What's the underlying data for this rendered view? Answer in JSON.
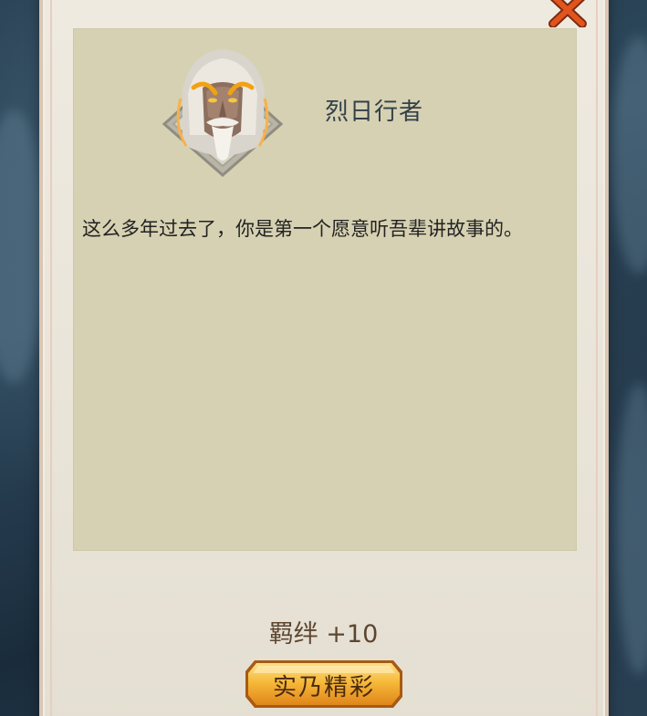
{
  "dialog": {
    "speaker_name": "烈日行者",
    "text": "这么多年过去了，你是第一个愿意听吾辈讲故事的。",
    "portrait_icon": "elder-portrait-icon"
  },
  "reward": {
    "label": "羁绊 +10"
  },
  "actions": {
    "confirm_label": "实乃精彩",
    "close_icon": "close-icon"
  },
  "colors": {
    "dialog_background": "#d6d1b2",
    "panel_background": "#e9e4d8",
    "close_accent": "#e2541e",
    "button_gold": "#f0a92a",
    "reward_text": "#5c4630"
  }
}
